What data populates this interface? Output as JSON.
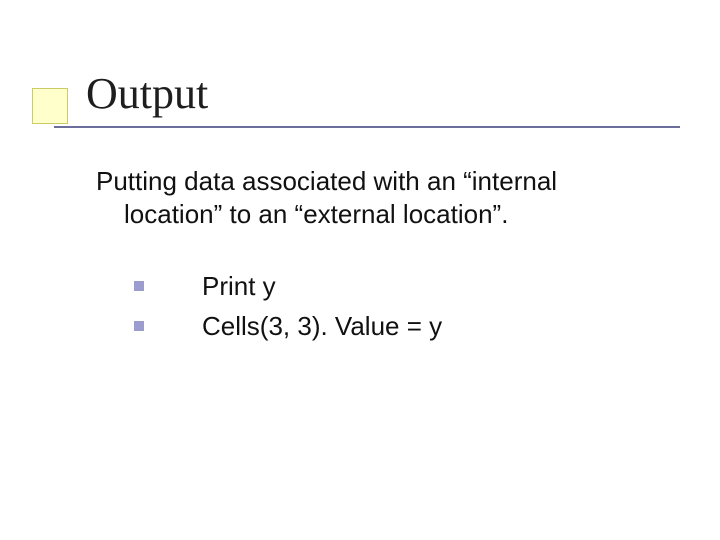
{
  "slide": {
    "title": "Output",
    "paragraph_line1": "Putting data associated with an “internal",
    "paragraph_line2": "location” to an “external location”.",
    "items": [
      "Print y",
      "Cells(3, 3). Value = y"
    ]
  }
}
